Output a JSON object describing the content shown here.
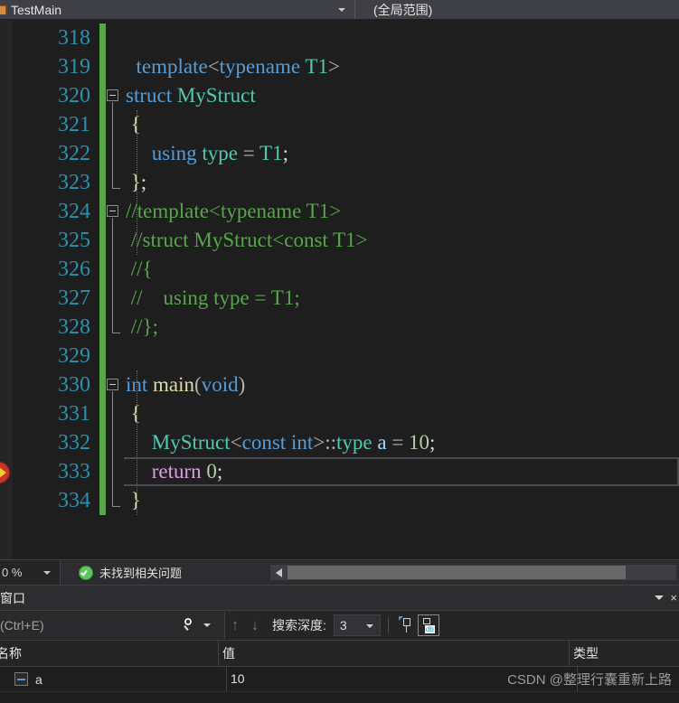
{
  "navbar": {
    "member_combo": {
      "label": "TestMain",
      "icon": "class-type-icon",
      "caret": "chevron-down-icon"
    },
    "scope_combo": {
      "label": "(全局范围)",
      "caret": "chevron-down-icon"
    }
  },
  "editor": {
    "first_line_number": 318,
    "current_statement_line": 333,
    "lines": [
      {
        "num": "318",
        "changed": true,
        "fold": "none",
        "tokens": []
      },
      {
        "num": "319",
        "changed": true,
        "fold": "none",
        "tokens": [
          {
            "t": "  ",
            "c": "plain"
          },
          {
            "t": "template",
            "c": "kw"
          },
          {
            "t": "<",
            "c": "op"
          },
          {
            "t": "typename",
            "c": "kw"
          },
          {
            "t": " ",
            "c": "plain"
          },
          {
            "t": "T1",
            "c": "type"
          },
          {
            "t": ">",
            "c": "op"
          }
        ]
      },
      {
        "num": "320",
        "changed": true,
        "fold": "start",
        "tokens": [
          {
            "t": "struct",
            "c": "kw"
          },
          {
            "t": " ",
            "c": "plain"
          },
          {
            "t": "MyStruct",
            "c": "type"
          }
        ]
      },
      {
        "num": "321",
        "changed": true,
        "fold": "mid",
        "tokens": [
          {
            "t": " {",
            "c": "punc"
          }
        ]
      },
      {
        "num": "322",
        "changed": true,
        "fold": "mid",
        "tokens": [
          {
            "t": "     ",
            "c": "plain"
          },
          {
            "t": "using",
            "c": "kw"
          },
          {
            "t": " ",
            "c": "plain"
          },
          {
            "t": "type",
            "c": "type"
          },
          {
            "t": " ",
            "c": "plain"
          },
          {
            "t": "=",
            "c": "op"
          },
          {
            "t": " ",
            "c": "plain"
          },
          {
            "t": "T1",
            "c": "type"
          },
          {
            "t": ";",
            "c": "plain"
          }
        ]
      },
      {
        "num": "323",
        "changed": true,
        "fold": "end",
        "tokens": [
          {
            "t": " }",
            "c": "punc"
          },
          {
            "t": ";",
            "c": "plain"
          }
        ]
      },
      {
        "num": "324",
        "changed": true,
        "fold": "start",
        "tokens": [
          {
            "t": "//template<typename T1>",
            "c": "cmt"
          }
        ]
      },
      {
        "num": "325",
        "changed": true,
        "fold": "mid",
        "tokens": [
          {
            "t": " //struct MyStruct<const T1>",
            "c": "cmt"
          }
        ]
      },
      {
        "num": "326",
        "changed": true,
        "fold": "mid",
        "tokens": [
          {
            "t": " //{",
            "c": "cmt"
          }
        ]
      },
      {
        "num": "327",
        "changed": true,
        "fold": "mid",
        "tokens": [
          {
            "t": " //    using type = T1;",
            "c": "cmt"
          }
        ]
      },
      {
        "num": "328",
        "changed": true,
        "fold": "end",
        "tokens": [
          {
            "t": " //};",
            "c": "cmt"
          }
        ]
      },
      {
        "num": "329",
        "changed": true,
        "fold": "none",
        "tokens": []
      },
      {
        "num": "330",
        "changed": true,
        "fold": "start",
        "tokens": [
          {
            "t": "int",
            "c": "kw"
          },
          {
            "t": " ",
            "c": "plain"
          },
          {
            "t": "main",
            "c": "punc"
          },
          {
            "t": "(",
            "c": "op"
          },
          {
            "t": "void",
            "c": "kw"
          },
          {
            "t": ")",
            "c": "op"
          }
        ]
      },
      {
        "num": "331",
        "changed": true,
        "fold": "mid",
        "tokens": [
          {
            "t": " {",
            "c": "punc"
          }
        ]
      },
      {
        "num": "332",
        "changed": true,
        "fold": "mid",
        "tokens": [
          {
            "t": "     ",
            "c": "plain"
          },
          {
            "t": "MyStruct",
            "c": "type"
          },
          {
            "t": "<",
            "c": "op"
          },
          {
            "t": "const",
            "c": "kw"
          },
          {
            "t": " ",
            "c": "plain"
          },
          {
            "t": "int",
            "c": "kw"
          },
          {
            "t": ">::",
            "c": "op"
          },
          {
            "t": "type",
            "c": "type"
          },
          {
            "t": " ",
            "c": "plain"
          },
          {
            "t": "a",
            "c": "id"
          },
          {
            "t": " ",
            "c": "plain"
          },
          {
            "t": "=",
            "c": "op"
          },
          {
            "t": " ",
            "c": "plain"
          },
          {
            "t": "10",
            "c": "num"
          },
          {
            "t": ";",
            "c": "plain"
          }
        ]
      },
      {
        "num": "333",
        "changed": true,
        "fold": "mid",
        "tokens": [
          {
            "t": "     ",
            "c": "plain"
          },
          {
            "t": "return",
            "c": "ctrl"
          },
          {
            "t": " ",
            "c": "plain"
          },
          {
            "t": "0",
            "c": "num"
          },
          {
            "t": ";",
            "c": "plain"
          }
        ]
      },
      {
        "num": "334",
        "changed": true,
        "fold": "end",
        "tokens": [
          {
            "t": " }",
            "c": "punc"
          }
        ]
      }
    ],
    "exec_marker": "execution-pointer-arrow-icon"
  },
  "status_strip": {
    "zoom_level": "0 %",
    "zoom_caret": "chevron-down-icon",
    "issue_icon": "check-circle-icon",
    "issue_text": "未找到相关问题",
    "scroll_left_arrow": "scroll-left-arrow-icon"
  },
  "autos_panel": {
    "title": "动窗口",
    "collapse_caret": "chevron-down-icon",
    "close_label": "×",
    "toolbar": {
      "search_placeholder": "索(Ctrl+E)",
      "search_icon": "search-icon",
      "search_caret": "chevron-down-icon",
      "up_arrow": "↑",
      "down_arrow": "↓",
      "depth_label": "搜索深度:",
      "depth_value": "3",
      "depth_caret": "chevron-down-icon",
      "pin_icon": "pin-icon",
      "hex_icon": "hex-display-icon",
      "hex_sub_label": "db"
    },
    "columns": [
      "名称",
      "值",
      "类型"
    ],
    "rows": [
      {
        "expander": "collapse-box-icon",
        "name": "a",
        "value": "10",
        "type": ""
      }
    ]
  },
  "watermark": "CSDN @整理行囊重新上路"
}
